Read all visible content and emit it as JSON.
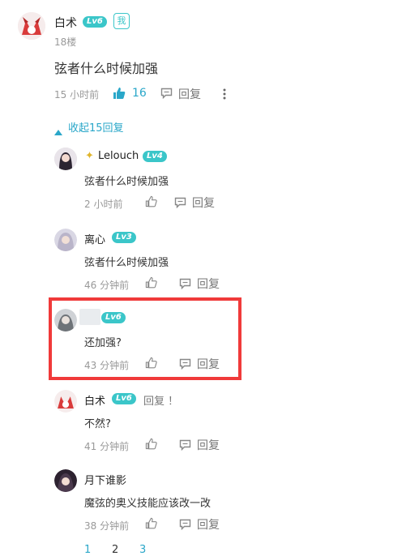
{
  "main_comment": {
    "username": "白术",
    "level": "Lv6",
    "tag": "我",
    "floor": "18楼",
    "content": "弦者什么时候加强",
    "time": "15 小时前",
    "likes": "16",
    "reply_label": "回复",
    "more_icon": "more-vertical-icon"
  },
  "collapse": {
    "label": "收起15回复"
  },
  "replies": [
    {
      "username": "Lelouch",
      "level": "Lv4",
      "content": "弦者什么时候加强",
      "time": "2 小时前",
      "reply_label": "回复",
      "level_color": "#3bc6c9"
    },
    {
      "username": "离心",
      "level": "Lv3",
      "content": "弦者什么时候加强",
      "time": "46 分钟前",
      "reply_label": "回复",
      "level_color": "#3bc6c9"
    },
    {
      "username": "",
      "level": "Lv6",
      "content": "还加强?",
      "time": "43 分钟前",
      "reply_label": "回复",
      "level_color": "#3bc6c9"
    },
    {
      "username": "白术",
      "level": "Lv6",
      "mention": "回复 ！",
      "content": "不然?",
      "time": "41 分钟前",
      "reply_label": "回复",
      "level_color": "#3bc6c9"
    },
    {
      "username": "月下谁影",
      "level": "",
      "content": "魔弦的奥义技能应该改一改",
      "time": "38 分钟前",
      "reply_label": "回复",
      "level_color": "#3bc6c9"
    }
  ],
  "pagination": {
    "pages": [
      "1",
      "2",
      "3"
    ],
    "current": "2"
  },
  "colors": {
    "accent": "#2aa7c9",
    "level": "#3bc6c9",
    "highlight": "#f03a3a"
  }
}
